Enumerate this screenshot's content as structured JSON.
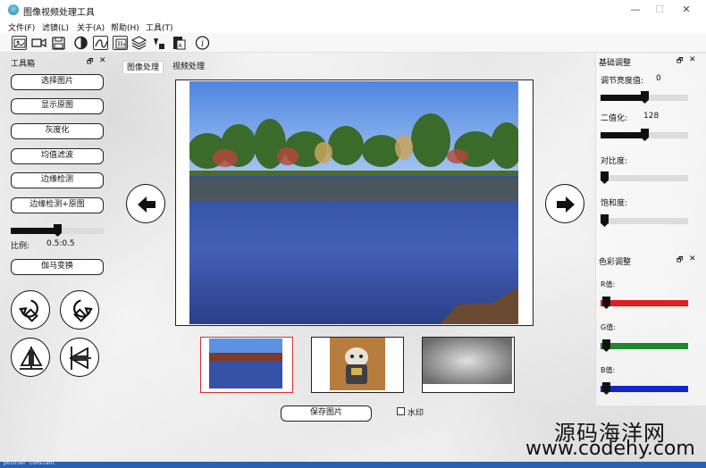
{
  "window": {
    "title": "图像视频处理工具",
    "minimize": "—",
    "maximize": "☐",
    "close": "✕"
  },
  "menu": [
    "文件(F)",
    "滤镜(L)",
    "关于(A)",
    "帮助(H)",
    "工具(T)"
  ],
  "toolbox": {
    "title": "工具箱",
    "float": "🗗",
    "close": "✕",
    "buttons": [
      "选择图片",
      "显示原图",
      "灰度化",
      "均值滤波",
      "边缘检测",
      "边缘检测+原图"
    ],
    "ratio_label": "比例:",
    "ratio_value": "0.5:0.5",
    "ratio_level": 0.5,
    "gamma_button": "伽马变换"
  },
  "tabs": [
    "图像处理",
    "视频处理"
  ],
  "save_button": "保存图片",
  "watermark_label": "水印",
  "basic": {
    "title": "基础调整",
    "float": "🗗",
    "close": "✕",
    "brightness_label": "调节亮度值:",
    "brightness_value": "0",
    "brightness_level": 0.5,
    "binary_label": "二值化:",
    "binary_value": "128",
    "binary_level": 0.5,
    "contrast_label": "对比度:",
    "contrast_level": 0,
    "saturation_label": "饱和度:",
    "saturation_level": 0
  },
  "color": {
    "title": "色彩调整",
    "float": "🗗",
    "close": "✕",
    "r_label": "R值:",
    "g_label": "G值:",
    "b_label": "B值:",
    "r_color": "#e41e1e",
    "g_color": "#1a8a2a",
    "b_color": "#1224d0"
  },
  "watermark_text": {
    "line1": "源码海洋网",
    "line2": "www.codehy.com"
  },
  "status": "pointer constant"
}
